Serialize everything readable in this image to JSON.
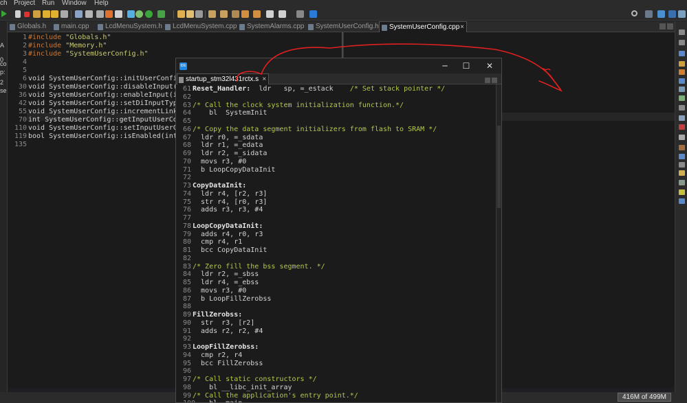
{
  "menu": [
    "ch",
    "Project",
    "Run",
    "Window",
    "Help"
  ],
  "left_strip": [
    "A",
    "0",
    "co",
    "p:",
    "2",
    "se"
  ],
  "tabs": [
    {
      "label": "Globals.h",
      "active": false
    },
    {
      "label": "main.cpp",
      "active": false
    },
    {
      "label": "LcdMenuSystem.h",
      "active": false
    },
    {
      "label": "LcdMenuSystem.cpp",
      "active": false
    },
    {
      "label": "SystemAlarms.cpp",
      "active": false
    },
    {
      "label": "SystemUserConfig.h",
      "active": false
    },
    {
      "label": "SystemUserConfig.cpp",
      "active": true
    }
  ],
  "editor": {
    "lines": [
      {
        "n": "1",
        "text": "#include \"Globals.h\""
      },
      {
        "n": "2",
        "text": "#include \"Memory.h\""
      },
      {
        "n": "3",
        "text": "#include \"SystemUserConfig.h\""
      },
      {
        "n": "4",
        "text": ""
      },
      {
        "n": "5",
        "text": ""
      },
      {
        "n": "6",
        "text": "void SystemUserConfig::initUserConfig(voi"
      },
      {
        "n": "30",
        "text": "void SystemUserConfig::disableInput(int i"
      },
      {
        "n": "36",
        "text": "void SystemUserConfig::enableInput(int sy"
      },
      {
        "n": "42",
        "text": "void SystemUserConfig::setDiInputType(int"
      },
      {
        "n": "55",
        "text": "void SystemUserConfig::incrementLinkedSol"
      },
      {
        "n": "70",
        "text": "int SystemUserConfig::getInputUserConfig"
      },
      {
        "n": "110",
        "text": "void SystemUserConfig::setInputUserConfig"
      },
      {
        "n": "119",
        "text": "bool SystemUserConfig::isEnabled(int syst"
      },
      {
        "n": "135",
        "text": ""
      }
    ]
  },
  "floating_window": {
    "tab_label": "startup_stm32l431rctx.s",
    "ide_badge": "IDE",
    "minimize": "─",
    "maximize": "☐",
    "close": "✕",
    "lines": [
      {
        "n": "61",
        "label": "Reset_Handler:",
        "code": "  ldr   sp, =_estack",
        "comment": "    /* Set stack pointer */"
      },
      {
        "n": "62",
        "label": "",
        "code": "",
        "comment": ""
      },
      {
        "n": "63",
        "label": "",
        "code": "",
        "comment": "/* Call the clock system initialization function.*/"
      },
      {
        "n": "64",
        "label": "",
        "code": "    bl  SystemInit",
        "comment": ""
      },
      {
        "n": "65",
        "label": "",
        "code": "",
        "comment": ""
      },
      {
        "n": "66",
        "label": "",
        "code": "",
        "comment": "/* Copy the data segment initializers from flash to SRAM */"
      },
      {
        "n": "67",
        "label": "",
        "code": "  ldr r0, =_sdata",
        "comment": ""
      },
      {
        "n": "68",
        "label": "",
        "code": "  ldr r1, =_edata",
        "comment": ""
      },
      {
        "n": "69",
        "label": "",
        "code": "  ldr r2, =_sidata",
        "comment": ""
      },
      {
        "n": "70",
        "label": "",
        "code": "  movs r3, #0",
        "comment": ""
      },
      {
        "n": "71",
        "label": "",
        "code": "  b LoopCopyDataInit",
        "comment": ""
      },
      {
        "n": "72",
        "label": "",
        "code": "",
        "comment": ""
      },
      {
        "n": "73",
        "label": "CopyDataInit:",
        "code": "",
        "comment": ""
      },
      {
        "n": "74",
        "label": "",
        "code": "  ldr r4, [r2, r3]",
        "comment": ""
      },
      {
        "n": "75",
        "label": "",
        "code": "  str r4, [r0, r3]",
        "comment": ""
      },
      {
        "n": "76",
        "label": "",
        "code": "  adds r3, r3, #4",
        "comment": ""
      },
      {
        "n": "77",
        "label": "",
        "code": "",
        "comment": ""
      },
      {
        "n": "78",
        "label": "LoopCopyDataInit:",
        "code": "",
        "comment": ""
      },
      {
        "n": "79",
        "label": "",
        "code": "  adds r4, r0, r3",
        "comment": ""
      },
      {
        "n": "80",
        "label": "",
        "code": "  cmp r4, r1",
        "comment": ""
      },
      {
        "n": "81",
        "label": "",
        "code": "  bcc CopyDataInit",
        "comment": ""
      },
      {
        "n": "82",
        "label": "",
        "code": "",
        "comment": ""
      },
      {
        "n": "83",
        "label": "",
        "code": "",
        "comment": "/* Zero fill the bss segment. */"
      },
      {
        "n": "84",
        "label": "",
        "code": "  ldr r2, =_sbss",
        "comment": ""
      },
      {
        "n": "85",
        "label": "",
        "code": "  ldr r4, =_ebss",
        "comment": ""
      },
      {
        "n": "86",
        "label": "",
        "code": "  movs r3, #0",
        "comment": ""
      },
      {
        "n": "87",
        "label": "",
        "code": "  b LoopFillZerobss",
        "comment": ""
      },
      {
        "n": "88",
        "label": "",
        "code": "",
        "comment": ""
      },
      {
        "n": "89",
        "label": "FillZerobss:",
        "code": "",
        "comment": ""
      },
      {
        "n": "90",
        "label": "",
        "code": "  str  r3, [r2]",
        "comment": ""
      },
      {
        "n": "91",
        "label": "",
        "code": "  adds r2, r2, #4",
        "comment": ""
      },
      {
        "n": "92",
        "label": "",
        "code": "",
        "comment": ""
      },
      {
        "n": "93",
        "label": "LoopFillZerobss:",
        "code": "",
        "comment": ""
      },
      {
        "n": "94",
        "label": "",
        "code": "  cmp r2, r4",
        "comment": ""
      },
      {
        "n": "95",
        "label": "",
        "code": "  bcc FillZerobss",
        "comment": ""
      },
      {
        "n": "96",
        "label": "",
        "code": "",
        "comment": ""
      },
      {
        "n": "97",
        "label": "",
        "code": "",
        "comment": "/* Call static constructors */"
      },
      {
        "n": "98",
        "label": "",
        "code": "    bl __libc_init_array",
        "comment": ""
      },
      {
        "n": "99",
        "label": "",
        "code": "",
        "comment": "/* Call the application's entry point.*/"
      },
      {
        "n": "100",
        "label": "",
        "code": "    bl  main",
        "comment": ""
      }
    ]
  },
  "status": {
    "memory": "416M of 499M"
  },
  "colors": {
    "annotation": "#e02020",
    "ide_badge": "#1e88e5",
    "comment": "#b5c94a"
  }
}
